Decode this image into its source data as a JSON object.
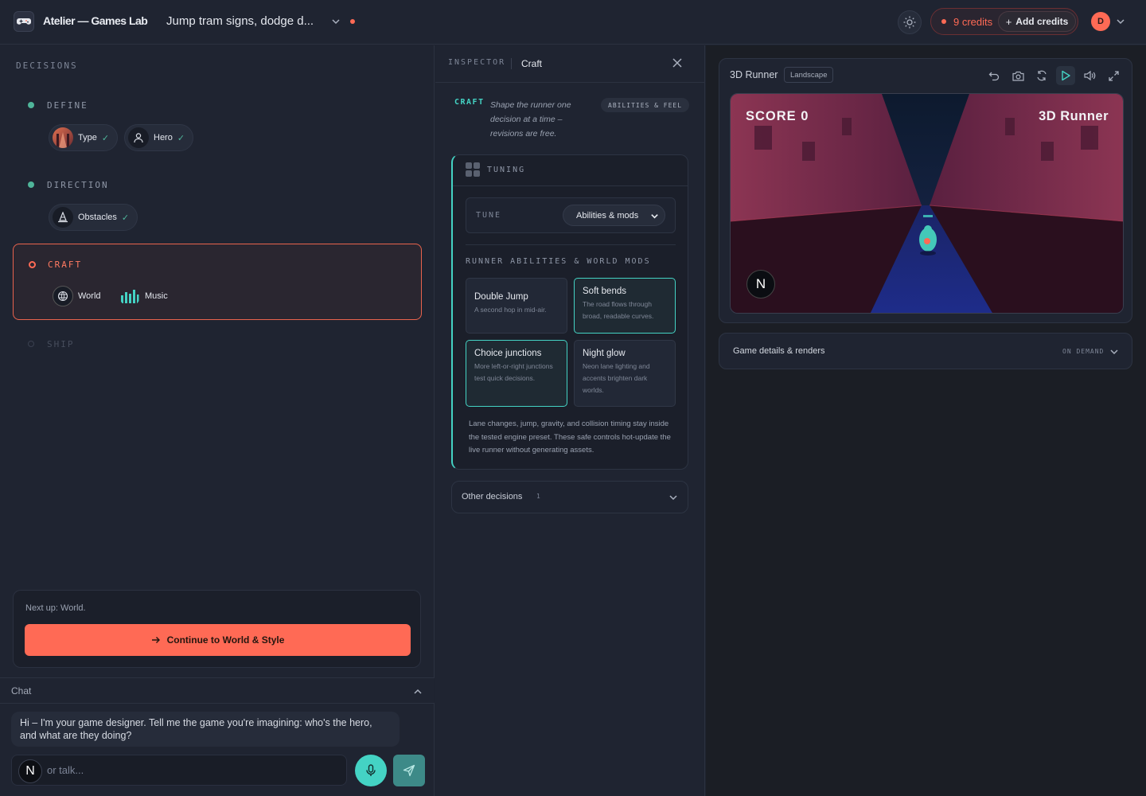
{
  "header": {
    "brand": "Atelier — Games Lab",
    "project_title": "Jump tram signs, dodge d...",
    "credits": "9 credits",
    "add_credits": "Add credits",
    "avatar_initial": "D"
  },
  "decisions": {
    "title": "DECISIONS",
    "stages": [
      {
        "label": "DEFINE",
        "items": [
          {
            "label": "Type",
            "done": true
          },
          {
            "label": "Hero",
            "done": true
          }
        ]
      },
      {
        "label": "DIRECTION",
        "items": [
          {
            "label": "Obstacles",
            "done": true
          }
        ]
      },
      {
        "label": "CRAFT",
        "items": [
          {
            "label": "World"
          },
          {
            "label": "Music"
          }
        ]
      },
      {
        "label": "SHIP"
      }
    ]
  },
  "next_up": {
    "text": "Next up: World.",
    "button": "Continue to World & Style"
  },
  "chat": {
    "title": "Chat",
    "message": "Hi – I'm your game designer. Tell me the game you're imagining: who's the hero, and what are they doing?",
    "input_badge": "N",
    "placeholder": "or talk..."
  },
  "inspector": {
    "title": "INSPECTOR",
    "tab": "Craft",
    "craft_tag": "CRAFT",
    "craft_desc": "Shape the runner one decision at a time – revisions are free.",
    "badge": "ABILITIES & FEEL",
    "tuning": {
      "title": "TUNING",
      "tune_label": "TUNE",
      "tune_value": "Abilities & mods",
      "section_title": "RUNNER ABILITIES & WORLD MODS",
      "cards": [
        {
          "title": "Double Jump",
          "desc": "A second hop in mid-air.",
          "selected": false
        },
        {
          "title": "Soft bends",
          "desc": "The road flows through broad, readable curves.",
          "selected": true
        },
        {
          "title": "Choice junctions",
          "desc": "More left-or-right junctions test quick decisions.",
          "selected": true
        },
        {
          "title": "Night glow",
          "desc": "Neon lane lighting and accents brighten dark worlds.",
          "selected": false
        }
      ],
      "note": "Lane changes, jump, gravity, and collision timing stay inside the tested engine preset. These safe controls hot-update the live runner without generating assets."
    },
    "other": {
      "label": "Other decisions",
      "count": "1"
    }
  },
  "preview": {
    "title": "3D Runner",
    "orientation": "Landscape",
    "score": "SCORE 0",
    "game_title": "3D Runner",
    "badge": "N",
    "tools": [
      "undo-icon",
      "camera-icon",
      "refresh-icon",
      "play-icon",
      "volume-icon",
      "expand-icon"
    ],
    "details_label": "Game details & renders",
    "details_badge": "ON DEMAND"
  },
  "colors": {
    "accent": "#ff6a55",
    "teal": "#44d3c4",
    "green": "#4fb59a",
    "bg": "#1f2431"
  }
}
